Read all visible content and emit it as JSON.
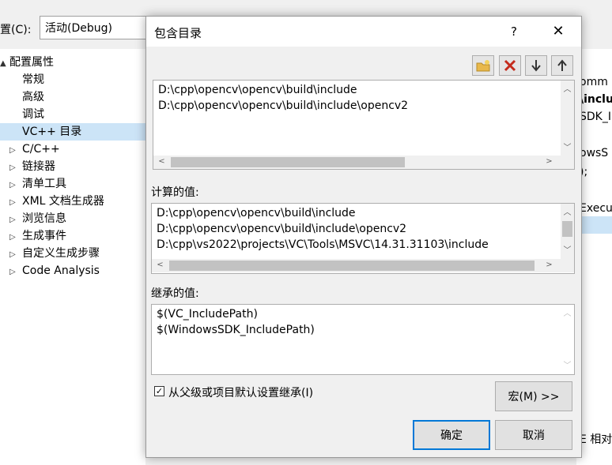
{
  "background": {
    "config_label": "置(C):",
    "config_value": "活动(Debug)",
    "tree": [
      {
        "label": "配置属性",
        "arrow": "▲",
        "indent": 0
      },
      {
        "label": "常规",
        "arrow": "",
        "indent": 1
      },
      {
        "label": "高级",
        "arrow": "",
        "indent": 1
      },
      {
        "label": "调试",
        "arrow": "",
        "indent": 1
      },
      {
        "label": "VC++ 目录",
        "arrow": "",
        "indent": 1,
        "selected": true
      },
      {
        "label": "C/C++",
        "arrow": "▷",
        "indent": 1
      },
      {
        "label": "链接器",
        "arrow": "▷",
        "indent": 1
      },
      {
        "label": "清单工具",
        "arrow": "▷",
        "indent": 1
      },
      {
        "label": "XML 文档生成器",
        "arrow": "▷",
        "indent": 1
      },
      {
        "label": "浏览信息",
        "arrow": "▷",
        "indent": 1
      },
      {
        "label": "生成事件",
        "arrow": "▷",
        "indent": 1
      },
      {
        "label": "自定义生成步骤",
        "arrow": "▷",
        "indent": 1
      },
      {
        "label": "Code Analysis",
        "arrow": "▷",
        "indent": 1
      }
    ],
    "right_fragments": [
      "omm",
      "\\inclu",
      "SDK_I",
      "owsS",
      ");",
      "Execu",
      "E 相对"
    ]
  },
  "dialog": {
    "title": "包含目录",
    "help_label": "?",
    "close_label": "✕",
    "toolbar": {
      "new_line_tooltip": "new-folder",
      "delete_tooltip": "delete",
      "down_tooltip": "move-down",
      "up_tooltip": "move-up"
    },
    "edit_lines": [
      "D:\\cpp\\opencv\\opencv\\build\\include",
      "D:\\cpp\\opencv\\opencv\\build\\include\\opencv2"
    ],
    "computed_label": "计算的值:",
    "computed_lines": [
      "D:\\cpp\\opencv\\opencv\\build\\include",
      "D:\\cpp\\opencv\\opencv\\build\\include\\opencv2",
      "D:\\cpp\\vs2022\\projects\\VC\\Tools\\MSVC\\14.31.31103\\include"
    ],
    "inherited_label": "继承的值:",
    "inherited_lines": [
      "$(VC_IncludePath)",
      "$(WindowsSDK_IncludePath)"
    ],
    "inherit_checkbox_label": "从父级或项目默认设置继承(I)",
    "inherit_checked": true,
    "macro_button": "宏(M) >>",
    "ok_button": "确定",
    "cancel_button": "取消"
  },
  "colors": {
    "accent": "#0078d7",
    "selection": "#cce4f7",
    "delete_red": "#c42b1c",
    "folder_yellow": "#e8b84a"
  }
}
